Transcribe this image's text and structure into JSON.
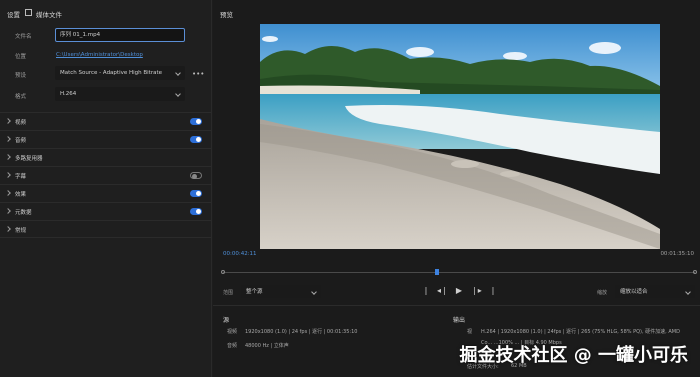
{
  "left": {
    "settings_title": "设置",
    "media_file_label": "媒体文件",
    "filename_label": "文件名",
    "filename_value": "序列 01_1.mp4",
    "location_label": "位置",
    "location_value": "C:\\Users\\Administrator\\Desktop",
    "preset_label": "预设",
    "preset_value": "Match Source - Adaptive High Bitrate",
    "format_label": "格式",
    "format_value": "H.264",
    "sections": [
      {
        "label": "视频",
        "toggle": "on"
      },
      {
        "label": "音频",
        "toggle": "on"
      },
      {
        "label": "多路复用器",
        "toggle": "none"
      },
      {
        "label": "字幕",
        "toggle": "off"
      },
      {
        "label": "效果",
        "toggle": "on"
      },
      {
        "label": "元数据",
        "toggle": "on"
      },
      {
        "label": "常规",
        "toggle": "none"
      }
    ]
  },
  "preview": {
    "title": "预览",
    "timecode_start": "00:00:42:11",
    "timecode_end": "00:01:35:10",
    "progress_fraction": 0.45,
    "range_label": "范围",
    "range_value": "整个源",
    "zoom_label": "缩放",
    "zoom_value": "缩放以适合"
  },
  "source": {
    "title": "源",
    "video_label": "视频",
    "video_value": "1920x1080 (1.0) | 24 fps | 逐行 | 00:01:35:10",
    "audio_label": "音频",
    "audio_value": "48000 Hz | 立体声"
  },
  "output": {
    "title": "输出",
    "video_label": "视",
    "video_value": "H.264 | 1920x1080 (1.0) | 24fps | 逐行 | 265 (75% HLG, 58% PQ), 硬件加速, AMD",
    "line2": "Co...  ...100%  ... | 目标 4.90 Mbps",
    "size_label": "估计文件大小:",
    "size_value": "62 MB"
  },
  "watermark": "掘金技术社区 @ 一罐小可乐"
}
